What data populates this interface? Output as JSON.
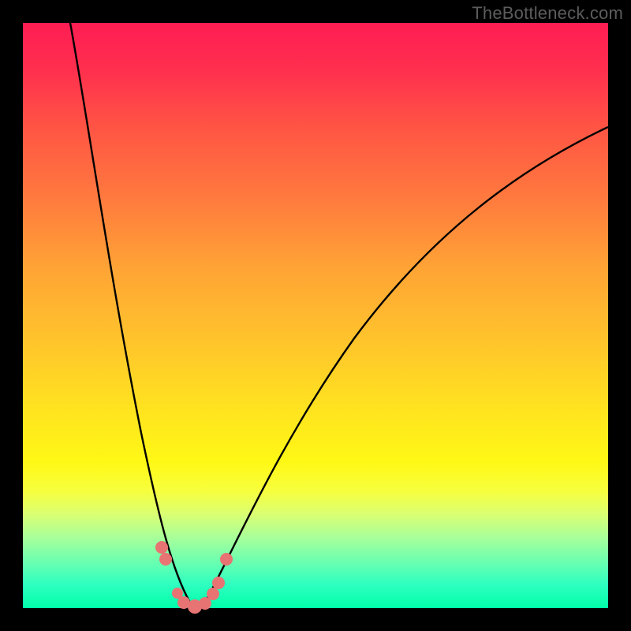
{
  "watermark": "TheBottleneck.com",
  "colors": {
    "background": "#000000",
    "curve_stroke": "#000000",
    "marker_fill": "#e77373"
  },
  "chart_data": {
    "type": "line",
    "title": "",
    "xlabel": "",
    "ylabel": "",
    "xlim": [
      0,
      100
    ],
    "ylim": [
      0,
      100
    ],
    "curves": [
      {
        "name": "left-branch",
        "note": "steep descending curve from top-left toward minimum",
        "points": [
          {
            "x": 8,
            "y": 100
          },
          {
            "x": 10,
            "y": 90
          },
          {
            "x": 12,
            "y": 78
          },
          {
            "x": 15,
            "y": 60
          },
          {
            "x": 18,
            "y": 42
          },
          {
            "x": 21,
            "y": 25
          },
          {
            "x": 23,
            "y": 14
          },
          {
            "x": 25,
            "y": 6
          },
          {
            "x": 27,
            "y": 1
          },
          {
            "x": 29,
            "y": 0
          }
        ]
      },
      {
        "name": "right-branch",
        "note": "rising curve from minimum toward upper-right, decelerating",
        "points": [
          {
            "x": 31,
            "y": 0
          },
          {
            "x": 33,
            "y": 2
          },
          {
            "x": 36,
            "y": 8
          },
          {
            "x": 41,
            "y": 20
          },
          {
            "x": 48,
            "y": 35
          },
          {
            "x": 57,
            "y": 49
          },
          {
            "x": 67,
            "y": 60
          },
          {
            "x": 78,
            "y": 69
          },
          {
            "x": 89,
            "y": 76
          },
          {
            "x": 100,
            "y": 82
          }
        ]
      }
    ],
    "markers": [
      {
        "x": 23.5,
        "y": 9,
        "r": 1.2
      },
      {
        "x": 24.5,
        "y": 7,
        "r": 1.2
      },
      {
        "x": 26.0,
        "y": 2,
        "r": 1.0
      },
      {
        "x": 27.5,
        "y": 0.5,
        "r": 1.2
      },
      {
        "x": 29.5,
        "y": 0,
        "r": 1.4
      },
      {
        "x": 31.0,
        "y": 0.5,
        "r": 1.2
      },
      {
        "x": 32.5,
        "y": 2,
        "r": 1.2
      },
      {
        "x": 33.5,
        "y": 4,
        "r": 1.2
      },
      {
        "x": 35.0,
        "y": 8,
        "r": 1.2
      }
    ]
  }
}
